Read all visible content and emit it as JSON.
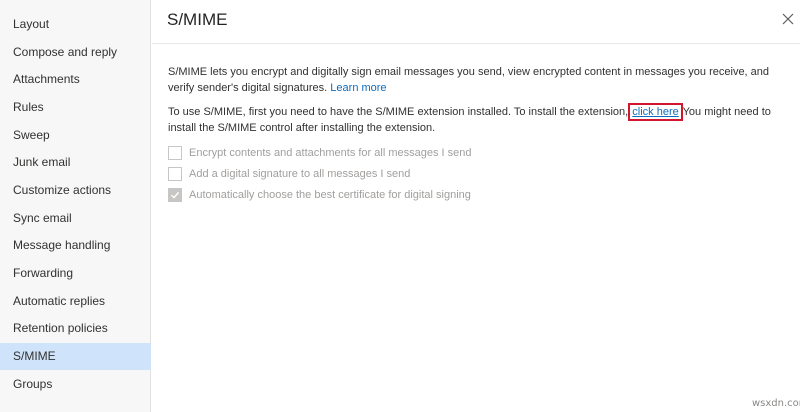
{
  "sidebar": {
    "items": [
      {
        "label": "Layout"
      },
      {
        "label": "Compose and reply"
      },
      {
        "label": "Attachments"
      },
      {
        "label": "Rules"
      },
      {
        "label": "Sweep"
      },
      {
        "label": "Junk email"
      },
      {
        "label": "Customize actions"
      },
      {
        "label": "Sync email"
      },
      {
        "label": "Message handling"
      },
      {
        "label": "Forwarding"
      },
      {
        "label": "Automatic replies"
      },
      {
        "label": "Retention policies"
      },
      {
        "label": "S/MIME",
        "selected": true
      },
      {
        "label": "Groups"
      }
    ]
  },
  "panel": {
    "title": "S/MIME",
    "close_icon": "close-icon",
    "intro": "S/MIME lets you encrypt and digitally sign email messages you send, view encrypted content in messages you receive, and verify sender's digital signatures.",
    "learn_more": "Learn more",
    "install_prefix": "To use S/MIME, first you need to have the S/MIME extension installed. To install the extension,",
    "click_here": "click here",
    "install_suffix": "You might need to install the S/MIME control after installing the extension.",
    "options": [
      {
        "label": "Encrypt contents and attachments for all messages I send",
        "checked": false
      },
      {
        "label": "Add a digital signature to all messages I send",
        "checked": false
      },
      {
        "label": "Automatically choose the best certificate for digital signing",
        "checked": true
      }
    ]
  },
  "colors": {
    "selected_bg": "#cfe4fa",
    "link": "#0f6cbd",
    "highlight_box": "#d2162e",
    "disabled_text": "#a19f9d"
  },
  "watermark": "wsxdn.com"
}
